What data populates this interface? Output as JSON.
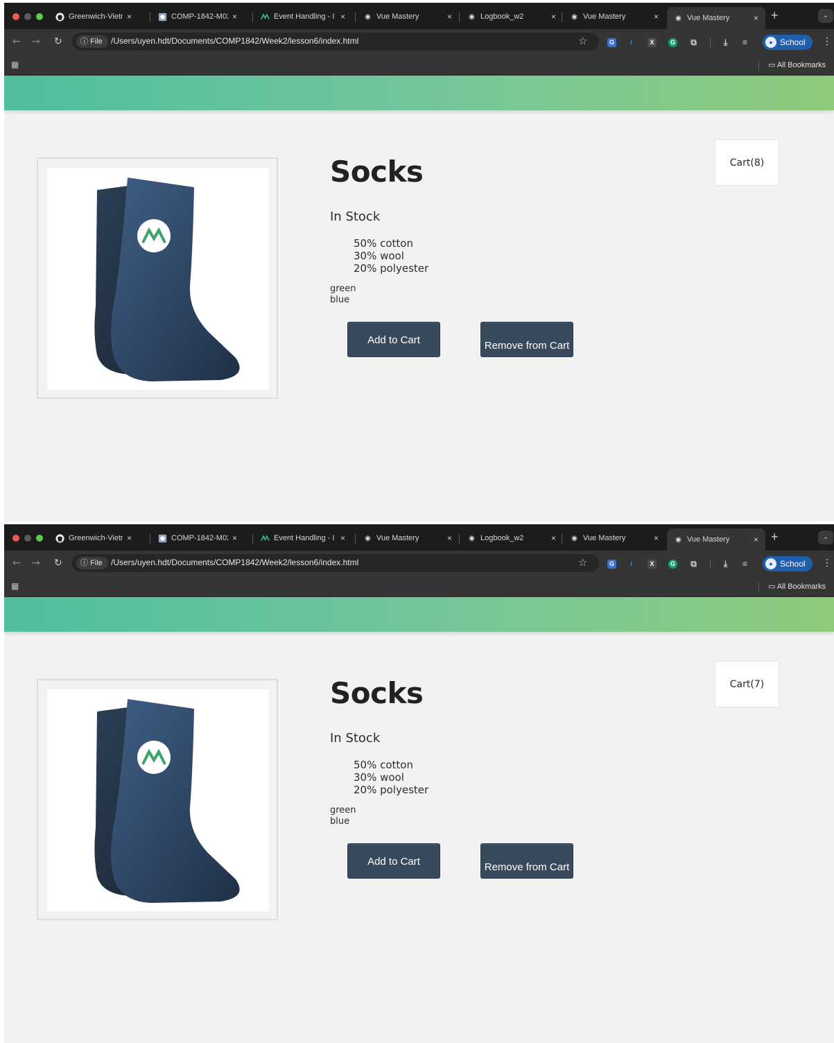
{
  "browser": {
    "tabs": [
      {
        "label": "Greenwich-Vietnar",
        "icon": "github-icon"
      },
      {
        "label": "COMP-1842-M02-",
        "icon": "course-icon"
      },
      {
        "label": "Event Handling - I",
        "icon": "vue-mastery-icon"
      },
      {
        "label": "Vue Mastery",
        "icon": "globe-icon"
      },
      {
        "label": "Logbook_w2",
        "icon": "globe-icon"
      },
      {
        "label": "Vue Mastery",
        "icon": "globe-icon"
      },
      {
        "label": "Vue Mastery",
        "icon": "globe-icon",
        "active": true
      }
    ],
    "file_chip": "File",
    "url": "/Users/uyen.hdt/Documents/COMP1842/Week2/lesson6/index.html",
    "profile": "School",
    "all_bookmarks": "All Bookmarks"
  },
  "screens": [
    {
      "cart": "Cart(8)",
      "product": {
        "title": "Socks",
        "stock": "In Stock",
        "details": [
          "50% cotton",
          "30% wool",
          "20% polyester"
        ],
        "variants": [
          "green",
          "blue"
        ],
        "add_button": "Add to Cart",
        "remove_button": "Remove from Cart"
      }
    },
    {
      "cart": "Cart(7)",
      "product": {
        "title": "Socks",
        "stock": "In Stock",
        "details": [
          "50% cotton",
          "30% wool",
          "20% polyester"
        ],
        "variants": [
          "green",
          "blue"
        ],
        "add_button": "Add to Cart",
        "remove_button": "Remove from Cart"
      }
    }
  ],
  "colors": {
    "navbar_start": "#4fbe9e",
    "navbar_end": "#8ecb7a",
    "button": "#39495c",
    "page_bg": "#f2f2f2"
  }
}
